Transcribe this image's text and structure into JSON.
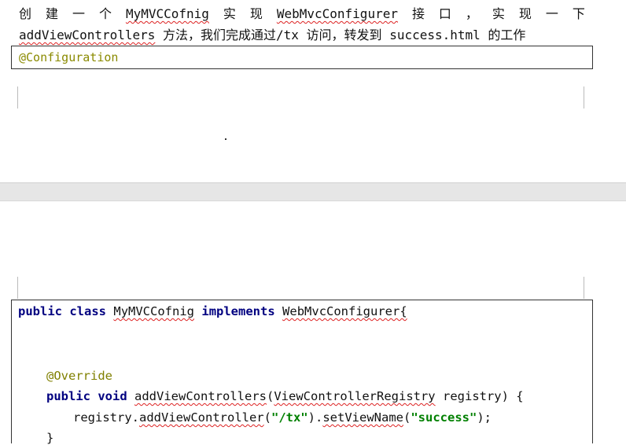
{
  "doc": {
    "line1_words": [
      "创",
      "建",
      "一",
      "个",
      "MyMVCCofnig",
      "实",
      "现",
      "WebMvcConfigurer",
      "接",
      "口",
      "，",
      "实",
      "现",
      "一",
      "下"
    ],
    "line2": {
      "method": "addViewControllers",
      "text_a": " 方法，我们完成通过/tx 访问，转发到 ",
      "file": "success.html",
      "text_b": " 的工作"
    },
    "box1_annotation": "@Configuration",
    "code": {
      "l1_kw1": "public",
      "l1_kw2": "class",
      "l1_name": "MyMVCCofnig",
      "l1_kw3": "implements",
      "l1_iface": "WebMvcConfigurer{",
      "l2_ann": "@Override",
      "l3_kw1": "public",
      "l3_kw2": "void",
      "l3_method": "addViewControllers",
      "l3_paren": "(",
      "l3_type": "ViewControllerRegistry",
      "l3_param": " registry) {",
      "l4_a": "registry.",
      "l4_method": "addViewController",
      "l4_b": "(",
      "l4_str1": "\"/tx\"",
      "l4_c": ").",
      "l4_method2": "setViewName",
      "l4_d": "(",
      "l4_str2": "\"success\"",
      "l4_e": ");",
      "l5": "}"
    }
  }
}
